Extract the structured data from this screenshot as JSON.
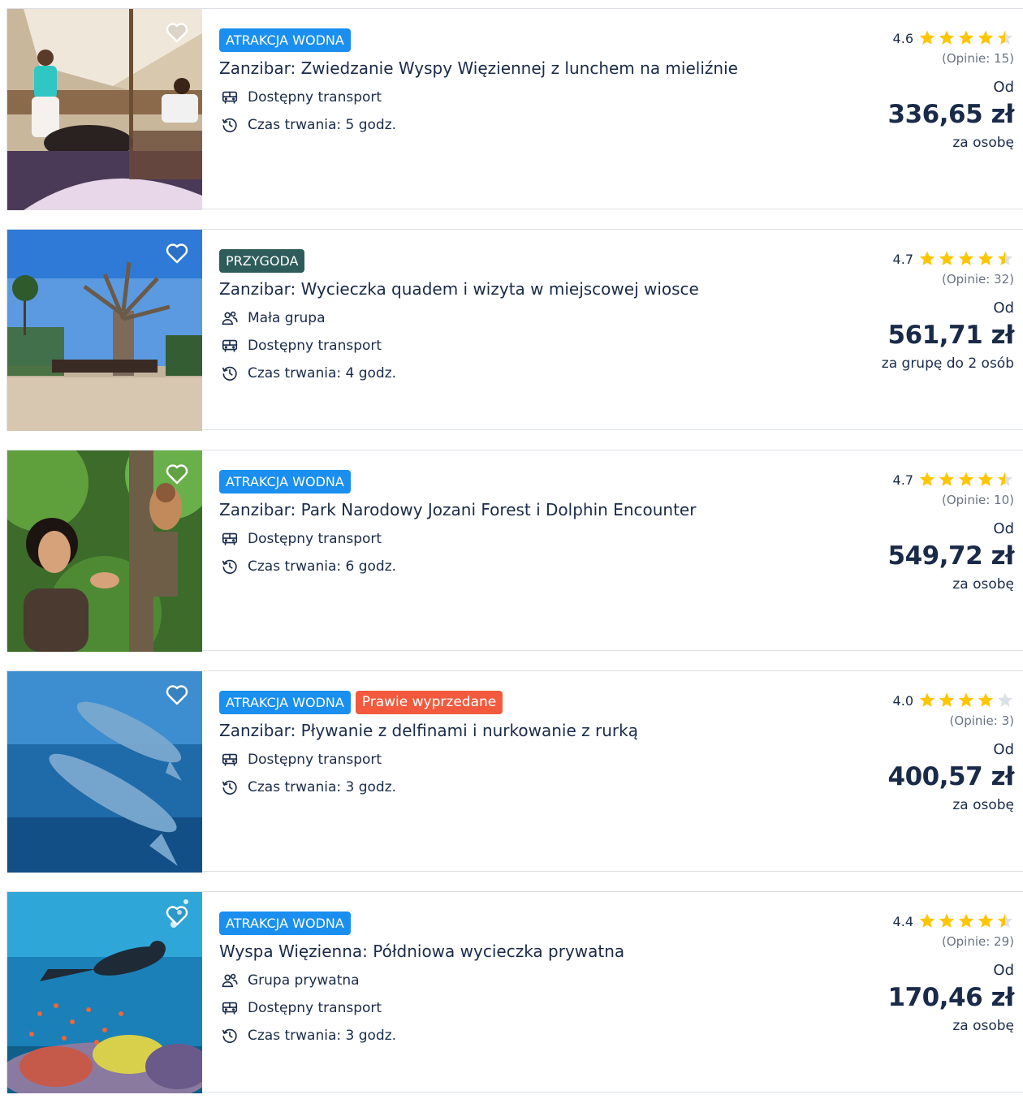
{
  "colors": {
    "badge_blue": "#1a8fef",
    "badge_dark": "#2e5c5a",
    "badge_red": "#f35a3d",
    "text": "#1a2b49",
    "star": "#fec600",
    "star_empty": "#dde1e6"
  },
  "offers": [
    {
      "badges": [
        {
          "label": "ATRAKCJA WODNA",
          "color": "blue"
        }
      ],
      "title": "Zanzibar: Zwiedzanie Wyspy Więziennej z lunchem na mieliźnie",
      "features": [
        {
          "icon": "bus-icon",
          "label": "Dostępny transport"
        },
        {
          "icon": "clock-icon",
          "label": "Czas trwania: 5 godz."
        }
      ],
      "rating": "4.6",
      "rating_value": 4.6,
      "reviews": "(Opinie: 15)",
      "from_label": "Od",
      "price": "336,65 zł",
      "per": "za osobę",
      "image": "sailboat-photo"
    },
    {
      "badges": [
        {
          "label": "PRZYGODA",
          "color": "dark"
        }
      ],
      "title": "Zanzibar: Wycieczka quadem i wizyta w miejscowej wiosce",
      "features": [
        {
          "icon": "group-icon",
          "label": "Mała grupa"
        },
        {
          "icon": "bus-icon",
          "label": "Dostępny transport"
        },
        {
          "icon": "clock-icon",
          "label": "Czas trwania: 4 godz."
        }
      ],
      "rating": "4.7",
      "rating_value": 4.7,
      "reviews": "(Opinie: 32)",
      "from_label": "Od",
      "price": "561,71 zł",
      "per": "za grupę do 2 osób",
      "image": "baobab-quads-photo"
    },
    {
      "badges": [
        {
          "label": "ATRAKCJA WODNA",
          "color": "blue"
        }
      ],
      "title": "Zanzibar: Park Narodowy Jozani Forest i Dolphin Encounter",
      "features": [
        {
          "icon": "bus-icon",
          "label": "Dostępny transport"
        },
        {
          "icon": "clock-icon",
          "label": "Czas trwania: 6 godz."
        }
      ],
      "rating": "4.7",
      "rating_value": 4.7,
      "reviews": "(Opinie: 10)",
      "from_label": "Od",
      "price": "549,72 zł",
      "per": "za osobę",
      "image": "forest-monkey-photo"
    },
    {
      "badges": [
        {
          "label": "ATRAKCJA WODNA",
          "color": "blue"
        },
        {
          "label": "Prawie wyprzedane",
          "color": "red"
        }
      ],
      "title": "Zanzibar: Pływanie z delfinami i nurkowanie z rurką",
      "features": [
        {
          "icon": "bus-icon",
          "label": "Dostępny transport"
        },
        {
          "icon": "clock-icon",
          "label": "Czas trwania: 3 godz."
        }
      ],
      "rating": "4.0",
      "rating_value": 4.0,
      "reviews": "(Opinie: 3)",
      "from_label": "Od",
      "price": "400,57 zł",
      "per": "za osobę",
      "image": "dolphins-photo"
    },
    {
      "badges": [
        {
          "label": "ATRAKCJA WODNA",
          "color": "blue"
        }
      ],
      "title": "Wyspa Więzienna: Półdniowa wycieczka prywatna",
      "features": [
        {
          "icon": "group-icon",
          "label": "Grupa prywatna"
        },
        {
          "icon": "bus-icon",
          "label": "Dostępny transport"
        },
        {
          "icon": "clock-icon",
          "label": "Czas trwania: 3 godz."
        }
      ],
      "rating": "4.4",
      "rating_value": 4.4,
      "reviews": "(Opinie: 29)",
      "from_label": "Od",
      "price": "170,46 zł",
      "per": "za osobę",
      "image": "diver-reef-photo"
    }
  ]
}
